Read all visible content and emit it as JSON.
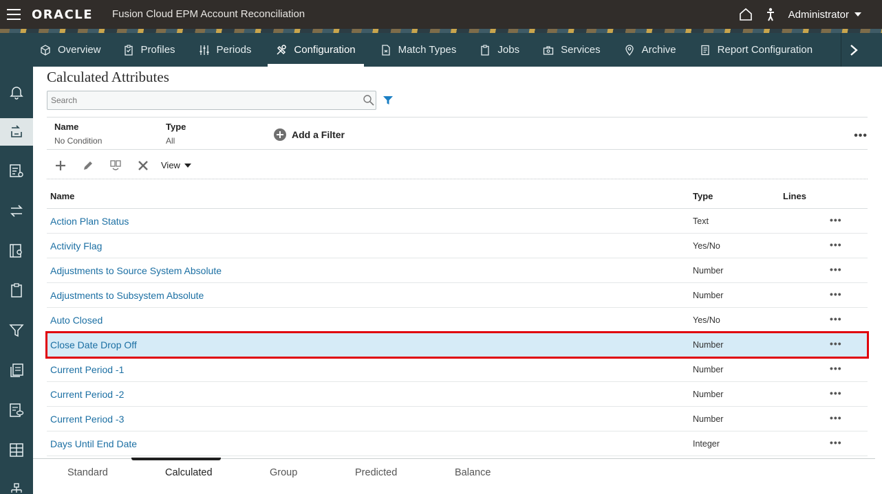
{
  "header": {
    "logo": "ORACLE",
    "app_title": "Fusion Cloud EPM Account Reconciliation",
    "user": "Administrator"
  },
  "nav": {
    "tabs": [
      {
        "label": "Overview",
        "icon": "cube-icon"
      },
      {
        "label": "Profiles",
        "icon": "clipboard-check-icon"
      },
      {
        "label": "Periods",
        "icon": "sliders-icon"
      },
      {
        "label": "Configuration",
        "icon": "tools-icon",
        "active": true
      },
      {
        "label": "Match Types",
        "icon": "match-doc-icon"
      },
      {
        "label": "Jobs",
        "icon": "clipboard-icon"
      },
      {
        "label": "Services",
        "icon": "toolbox-icon"
      },
      {
        "label": "Archive",
        "icon": "pin-icon"
      },
      {
        "label": "Report Configuration",
        "icon": "report-icon"
      }
    ]
  },
  "page": {
    "title": "Calculated Attributes",
    "search_placeholder": "Search"
  },
  "filters": {
    "name_label": "Name",
    "name_value": "No Condition",
    "type_label": "Type",
    "type_value": "All",
    "add_filter": "Add a Filter"
  },
  "toolbar": {
    "view_label": "View"
  },
  "table": {
    "columns": {
      "name": "Name",
      "type": "Type",
      "lines": "Lines"
    },
    "rows": [
      {
        "name": "Action Plan Status",
        "type": "Text"
      },
      {
        "name": "Activity Flag",
        "type": "Yes/No"
      },
      {
        "name": "Adjustments to Source System Absolute",
        "type": "Number"
      },
      {
        "name": "Adjustments to Subsystem Absolute",
        "type": "Number"
      },
      {
        "name": "Auto Closed",
        "type": "Yes/No"
      },
      {
        "name": "Close Date Drop Off",
        "type": "Number",
        "selected": true
      },
      {
        "name": "Current Period -1",
        "type": "Number"
      },
      {
        "name": "Current Period -2",
        "type": "Number"
      },
      {
        "name": "Current Period -3",
        "type": "Number"
      },
      {
        "name": "Days Until End Date",
        "type": "Integer"
      }
    ]
  },
  "bottom_tabs": [
    "Standard",
    "Calculated",
    "Group",
    "Predicted",
    "Balance"
  ],
  "active_bottom_tab": "Calculated",
  "colors": {
    "topbar": "#312d2a",
    "navbar": "#27454e",
    "link": "#1b6fa3",
    "selected_row": "#d6ebf7",
    "highlight": "#e0000b",
    "filter_accent": "#1b7fc4"
  }
}
